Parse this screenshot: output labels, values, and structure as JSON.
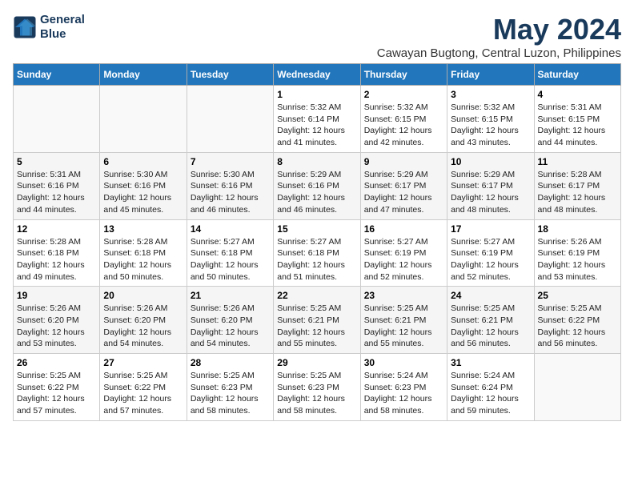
{
  "logo": {
    "line1": "General",
    "line2": "Blue"
  },
  "title": "May 2024",
  "subtitle": "Cawayan Bugtong, Central Luzon, Philippines",
  "header": {
    "days": [
      "Sunday",
      "Monday",
      "Tuesday",
      "Wednesday",
      "Thursday",
      "Friday",
      "Saturday"
    ]
  },
  "weeks": [
    {
      "cells": [
        {
          "day": "",
          "info": ""
        },
        {
          "day": "",
          "info": ""
        },
        {
          "day": "",
          "info": ""
        },
        {
          "day": "1",
          "info": "Sunrise: 5:32 AM\nSunset: 6:14 PM\nDaylight: 12 hours\nand 41 minutes."
        },
        {
          "day": "2",
          "info": "Sunrise: 5:32 AM\nSunset: 6:15 PM\nDaylight: 12 hours\nand 42 minutes."
        },
        {
          "day": "3",
          "info": "Sunrise: 5:32 AM\nSunset: 6:15 PM\nDaylight: 12 hours\nand 43 minutes."
        },
        {
          "day": "4",
          "info": "Sunrise: 5:31 AM\nSunset: 6:15 PM\nDaylight: 12 hours\nand 44 minutes."
        }
      ]
    },
    {
      "cells": [
        {
          "day": "5",
          "info": "Sunrise: 5:31 AM\nSunset: 6:16 PM\nDaylight: 12 hours\nand 44 minutes."
        },
        {
          "day": "6",
          "info": "Sunrise: 5:30 AM\nSunset: 6:16 PM\nDaylight: 12 hours\nand 45 minutes."
        },
        {
          "day": "7",
          "info": "Sunrise: 5:30 AM\nSunset: 6:16 PM\nDaylight: 12 hours\nand 46 minutes."
        },
        {
          "day": "8",
          "info": "Sunrise: 5:29 AM\nSunset: 6:16 PM\nDaylight: 12 hours\nand 46 minutes."
        },
        {
          "day": "9",
          "info": "Sunrise: 5:29 AM\nSunset: 6:17 PM\nDaylight: 12 hours\nand 47 minutes."
        },
        {
          "day": "10",
          "info": "Sunrise: 5:29 AM\nSunset: 6:17 PM\nDaylight: 12 hours\nand 48 minutes."
        },
        {
          "day": "11",
          "info": "Sunrise: 5:28 AM\nSunset: 6:17 PM\nDaylight: 12 hours\nand 48 minutes."
        }
      ]
    },
    {
      "cells": [
        {
          "day": "12",
          "info": "Sunrise: 5:28 AM\nSunset: 6:18 PM\nDaylight: 12 hours\nand 49 minutes."
        },
        {
          "day": "13",
          "info": "Sunrise: 5:28 AM\nSunset: 6:18 PM\nDaylight: 12 hours\nand 50 minutes."
        },
        {
          "day": "14",
          "info": "Sunrise: 5:27 AM\nSunset: 6:18 PM\nDaylight: 12 hours\nand 50 minutes."
        },
        {
          "day": "15",
          "info": "Sunrise: 5:27 AM\nSunset: 6:18 PM\nDaylight: 12 hours\nand 51 minutes."
        },
        {
          "day": "16",
          "info": "Sunrise: 5:27 AM\nSunset: 6:19 PM\nDaylight: 12 hours\nand 52 minutes."
        },
        {
          "day": "17",
          "info": "Sunrise: 5:27 AM\nSunset: 6:19 PM\nDaylight: 12 hours\nand 52 minutes."
        },
        {
          "day": "18",
          "info": "Sunrise: 5:26 AM\nSunset: 6:19 PM\nDaylight: 12 hours\nand 53 minutes."
        }
      ]
    },
    {
      "cells": [
        {
          "day": "19",
          "info": "Sunrise: 5:26 AM\nSunset: 6:20 PM\nDaylight: 12 hours\nand 53 minutes."
        },
        {
          "day": "20",
          "info": "Sunrise: 5:26 AM\nSunset: 6:20 PM\nDaylight: 12 hours\nand 54 minutes."
        },
        {
          "day": "21",
          "info": "Sunrise: 5:26 AM\nSunset: 6:20 PM\nDaylight: 12 hours\nand 54 minutes."
        },
        {
          "day": "22",
          "info": "Sunrise: 5:25 AM\nSunset: 6:21 PM\nDaylight: 12 hours\nand 55 minutes."
        },
        {
          "day": "23",
          "info": "Sunrise: 5:25 AM\nSunset: 6:21 PM\nDaylight: 12 hours\nand 55 minutes."
        },
        {
          "day": "24",
          "info": "Sunrise: 5:25 AM\nSunset: 6:21 PM\nDaylight: 12 hours\nand 56 minutes."
        },
        {
          "day": "25",
          "info": "Sunrise: 5:25 AM\nSunset: 6:22 PM\nDaylight: 12 hours\nand 56 minutes."
        }
      ]
    },
    {
      "cells": [
        {
          "day": "26",
          "info": "Sunrise: 5:25 AM\nSunset: 6:22 PM\nDaylight: 12 hours\nand 57 minutes."
        },
        {
          "day": "27",
          "info": "Sunrise: 5:25 AM\nSunset: 6:22 PM\nDaylight: 12 hours\nand 57 minutes."
        },
        {
          "day": "28",
          "info": "Sunrise: 5:25 AM\nSunset: 6:23 PM\nDaylight: 12 hours\nand 58 minutes."
        },
        {
          "day": "29",
          "info": "Sunrise: 5:25 AM\nSunset: 6:23 PM\nDaylight: 12 hours\nand 58 minutes."
        },
        {
          "day": "30",
          "info": "Sunrise: 5:24 AM\nSunset: 6:23 PM\nDaylight: 12 hours\nand 58 minutes."
        },
        {
          "day": "31",
          "info": "Sunrise: 5:24 AM\nSunset: 6:24 PM\nDaylight: 12 hours\nand 59 minutes."
        },
        {
          "day": "",
          "info": ""
        }
      ]
    }
  ]
}
